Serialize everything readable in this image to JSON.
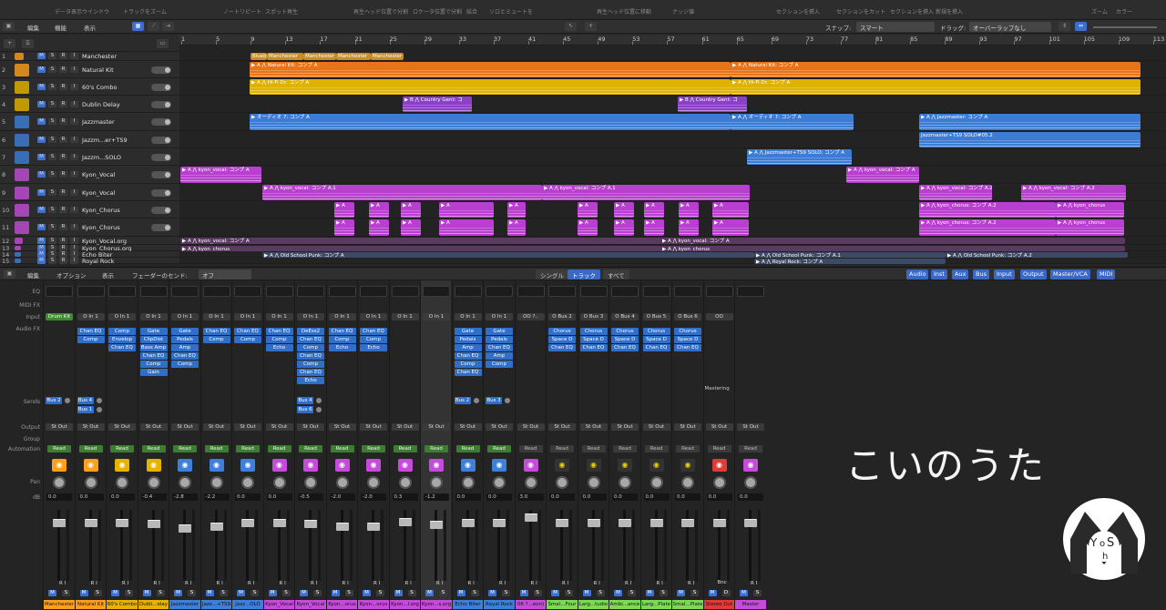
{
  "topbar": {
    "items": [
      "データ表示ウインドウ",
      "トラックをズーム",
      "ノートリピート",
      "スポット再生",
      "再生ヘッド位置で分割",
      "ロケータ位置で分割",
      "結合",
      "ソロとミュートを",
      "再生ヘッド位置に移動",
      "ナッジ値",
      "セクションを挿入",
      "セクションをカット",
      "セクションを挿入",
      "新規を挿入",
      "ズーム",
      "カラー"
    ]
  },
  "toolbar": {
    "edit": "編集",
    "func": "機能",
    "view": "表示",
    "snap_label": "スナップ:",
    "snap_value": "スマート",
    "drag_label": "ドラッグ:",
    "drag_value": "オーバーラップなし"
  },
  "ruler": [
    "1",
    "5",
    "9",
    "13",
    "17",
    "21",
    "25",
    "29",
    "33",
    "37",
    "41",
    "45",
    "49",
    "53",
    "57",
    "61",
    "65",
    "69",
    "73",
    "77",
    "81",
    "85",
    "89",
    "93",
    "97",
    "101",
    "105",
    "109",
    "113"
  ],
  "tracks": [
    {
      "num": "1",
      "name": "Manchester",
      "color": "#ff9f1a"
    },
    {
      "num": "2",
      "name": "Natural Kit",
      "color": "#ff9f1a"
    },
    {
      "num": "3",
      "name": "60's Combo",
      "color": "#e6b400"
    },
    {
      "num": "4",
      "name": "Dublin Delay",
      "color": "#e6b400"
    },
    {
      "num": "5",
      "name": "Jazzmaster",
      "color": "#3d7fd9"
    },
    {
      "num": "6",
      "name": "Jazzm...er+TS9",
      "color": "#3d7fd9"
    },
    {
      "num": "7",
      "name": "Jazzm...SOLO",
      "color": "#3d7fd9"
    },
    {
      "num": "8",
      "name": "Kyon_Vocal",
      "color": "#c54cd9"
    },
    {
      "num": "9",
      "name": "Kyon_Vocal",
      "color": "#c54cd9"
    },
    {
      "num": "10",
      "name": "Kyon_Chorus",
      "color": "#c54cd9"
    },
    {
      "num": "11",
      "name": "Kyon_Chorus",
      "color": "#c54cd9"
    },
    {
      "num": "12",
      "name": "Kyon_Vocal.org",
      "color": "#c54cd9"
    },
    {
      "num": "13",
      "name": "Kyon_Chorus.org",
      "color": "#c54cd9"
    },
    {
      "num": "14",
      "name": "Echo Biter",
      "color": "#3d7fd9"
    },
    {
      "num": "15",
      "name": "Royal Rock",
      "color": "#3d7fd9"
    }
  ],
  "regions": {
    "manchester": [
      "Blueb",
      "Manchester",
      "Manchester",
      "Manchester",
      "Manchester"
    ],
    "natural_kit": "Natural Kit: コンプ A",
    "hifi": "Hi-Fi Dr: コンプ A",
    "country": "Country Gent: コ",
    "audio7": "オーディオ 7: コンプ A",
    "jazzmaster": "Jazzmaster: コンプ A",
    "jazz_ts9": "Jazzmaster+TS9 SOLO#05.2",
    "jazz_solo": "Jazzmaster+TS9 SOLO: コンプ A",
    "kyon_vocal_a": "kyon_vocal: コンプ A",
    "kyon_vocal_a1": "kyon_vocal: コンプ A.1",
    "kyon_vocal_a2": "kyon_vocal: コンプ A.2",
    "kyon_chorus": "kyon_chorus",
    "kyon_chorus_a2": "kyon_chorus: コンプ A.2",
    "old_school": "Old School Punk: コンプ A",
    "old_school_1": "Old School Punk: コンプ A.1",
    "old_school_2": "Old School Punk: コンプ A.2",
    "royal": "Royal Rock: コンプ A",
    "a": "A"
  },
  "mixer_bar": {
    "edit": "編集",
    "options": "オプション",
    "view": "表示",
    "fader_send": "フェーダーのセンド:",
    "off": "オフ",
    "tabs": [
      "シングル",
      "トラック",
      "すべて"
    ],
    "filters": [
      "Audio",
      "Inst",
      "Aux",
      "Bus",
      "Input",
      "Output",
      "Master/VCA",
      "MIDI"
    ]
  },
  "row_labels": {
    "eq": "EQ",
    "midifx": "MIDI FX",
    "input": "Input",
    "audiofx": "Audio FX",
    "sends": "Sends",
    "output": "Output",
    "group": "Group",
    "automation": "Automation",
    "pan": "Pan",
    "db": "dB"
  },
  "strips": [
    {
      "name": "Manchester",
      "color": "#ff9f1a",
      "input": "Drum Kit",
      "fx": [],
      "sends": [
        "Bus 2"
      ],
      "db": "0.0",
      "auto": "Read",
      "icon": "drum-icon"
    },
    {
      "name": "Natural Kit",
      "color": "#ff9f1a",
      "input": "O  In 1",
      "fx": [
        "Chan EQ",
        "Comp"
      ],
      "sends": [
        "Bus 4",
        "Bus 1"
      ],
      "db": "0.0",
      "auto": "Read",
      "icon": "drum-icon"
    },
    {
      "name": "60's Combo",
      "color": "#e6b400",
      "input": "O  In 1",
      "fx": [
        "Comp",
        "Envelop",
        "Chan EQ"
      ],
      "sends": [],
      "db": "0.0",
      "auto": "Read",
      "icon": "amp-icon"
    },
    {
      "name": "Dubli...elay",
      "color": "#e6b400",
      "input": "O  In 1",
      "fx": [
        "Gate",
        "ClipDist",
        "Bass Amp",
        "Chan EQ",
        "Comp",
        "Gain"
      ],
      "sends": [],
      "db": "-0.4",
      "auto": "Read",
      "icon": "amp-icon"
    },
    {
      "name": "Jazzmaster",
      "color": "#3d7fd9",
      "input": "O  In 1",
      "fx": [
        "Gate",
        "Pedals",
        "Amp",
        "Chan EQ",
        "Comp"
      ],
      "sends": [],
      "db": "-2.8",
      "auto": "Read",
      "icon": "guitar-icon"
    },
    {
      "name": "Jazz...+TS9",
      "color": "#3d7fd9",
      "input": "O  In 1",
      "fx": [
        "Chan EQ",
        "Comp"
      ],
      "sends": [],
      "db": "-2.2",
      "auto": "Read",
      "icon": "guitar-icon"
    },
    {
      "name": "Jazz...OLO",
      "color": "#3d7fd9",
      "input": "O  In 1",
      "fx": [
        "Chan EQ",
        "Comp"
      ],
      "sends": [],
      "db": "0.0",
      "auto": "Read",
      "icon": "box-icon"
    },
    {
      "name": "Kyon_Vocal",
      "color": "#c54cd9",
      "input": "O  In 1",
      "fx": [
        "Chan EQ",
        "Comp",
        "Echo"
      ],
      "sends": [],
      "db": "0.0",
      "auto": "Read",
      "icon": "mic-icon"
    },
    {
      "name": "Kyon_Vocal",
      "color": "#c54cd9",
      "input": "O  In 1",
      "fx": [
        "DeEss2",
        "Chan EQ",
        "Comp",
        "Chan EQ",
        "Comp",
        "Chan EQ",
        "Echo"
      ],
      "sends": [
        "Bus 4",
        "Bus 6"
      ],
      "db": "-0.5",
      "auto": "Read",
      "icon": "mic-icon"
    },
    {
      "name": "Kyon...orus",
      "color": "#c54cd9",
      "input": "O  In 1",
      "fx": [
        "Chan EQ",
        "Comp",
        "Echo"
      ],
      "sends": [],
      "db": "-2.0",
      "auto": "Read",
      "icon": "wave-icon"
    },
    {
      "name": "Kyon...orus",
      "color": "#c54cd9",
      "input": "O  In 1",
      "fx": [
        "Chan EQ",
        "Comp",
        "Echo"
      ],
      "sends": [],
      "db": "-2.0",
      "auto": "Read",
      "icon": "wave-icon"
    },
    {
      "name": "Kyon...l.org",
      "color": "#c54cd9",
      "input": "O  In 1",
      "fx": [],
      "sends": [],
      "db": "0.3",
      "auto": "Read",
      "icon": "wave-icon"
    },
    {
      "name": "Kyon...s.org",
      "color": "#c54cd9",
      "input": "O  In 1",
      "fx": [],
      "sends": [],
      "db": "-1.2",
      "auto": "Read",
      "icon": "wave-icon"
    },
    {
      "name": "Echo Biter",
      "color": "#3d7fd9",
      "input": "O  In 1",
      "fx": [
        "Gate",
        "Pedals",
        "Amp",
        "Chan EQ",
        "Comp",
        "Chan EQ"
      ],
      "sends": [
        "Bus 2"
      ],
      "db": "0.0",
      "auto": "Read",
      "icon": "amp-icon"
    },
    {
      "name": "Royal Rock",
      "color": "#3d7fd9",
      "input": "O  In 1",
      "fx": [
        "Gate",
        "Pedals",
        "Chan EQ",
        "Amp",
        "Comp"
      ],
      "sends": [
        "Bus 3"
      ],
      "db": "0.0",
      "auto": "Read",
      "icon": "amp-icon"
    },
    {
      "name": "06 ?...eon)",
      "color": "#c54cd9",
      "input": "OO  ?..",
      "fx": [],
      "sends": [],
      "db": "3.0",
      "auto": "Read",
      "icon": "note-icon"
    },
    {
      "name": "Smal...Four",
      "color": "#7ed957",
      "input": "O  Bus 2",
      "fx": [
        "Chorus",
        "Space D",
        "Chan EQ"
      ],
      "sends": [],
      "db": "0.0",
      "auto": "Read",
      "icon": "clock-icon"
    },
    {
      "name": "Larg...tudio",
      "color": "#7ed957",
      "input": "O  Bus 3",
      "fx": [
        "Chorus",
        "Space D",
        "Chan EQ"
      ],
      "sends": [],
      "db": "0.0",
      "auto": "Read",
      "icon": "clock-icon"
    },
    {
      "name": "Ambi...ance",
      "color": "#7ed957",
      "input": "O  Bus 4",
      "fx": [
        "Chorus",
        "Space D",
        "Chan EQ"
      ],
      "sends": [],
      "db": "0.0",
      "auto": "Read",
      "icon": "clock-icon"
    },
    {
      "name": "Larg...Plate",
      "color": "#7ed957",
      "input": "O  Bus 5",
      "fx": [
        "Chorus",
        "Space D",
        "Chan EQ"
      ],
      "sends": [],
      "db": "0.0",
      "auto": "Read",
      "icon": "clock-icon"
    },
    {
      "name": "Smal...Plate",
      "color": "#7ed957",
      "input": "O  Bus 6",
      "fx": [
        "Chorus",
        "Space D",
        "Chan EQ"
      ],
      "sends": [],
      "db": "0.0",
      "auto": "Read",
      "icon": "clock-icon"
    },
    {
      "name": "Stereo Out",
      "color": "#e03a3a",
      "input": "OO",
      "fx": [],
      "sends": [],
      "db": "0.0",
      "auto": "Read",
      "icon": "meter-icon",
      "extra": "Mastering",
      "bnc": "Bnc"
    },
    {
      "name": "Master",
      "color": "#c54cd9",
      "input": "",
      "fx": [],
      "sends": [],
      "db": "0.0",
      "auto": "Read",
      "icon": "meter-icon"
    }
  ],
  "common": {
    "st_out": "St Out",
    "m": "M",
    "s": "S",
    "r": "R",
    "i": "I",
    "d": "D"
  },
  "overlay": {
    "text": "こいのうた",
    "logo_letters": "YoSh"
  }
}
